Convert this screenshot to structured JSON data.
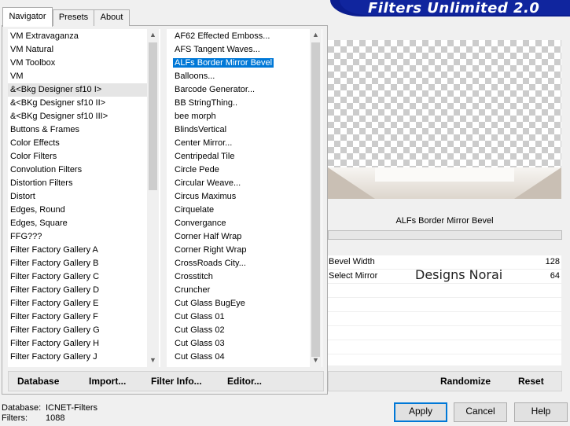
{
  "tabs": [
    "Navigator",
    "Presets",
    "About"
  ],
  "banner_title": "Filters Unlimited 2.0",
  "categories": {
    "items": [
      "VM Extravaganza",
      "VM Natural",
      "VM Toolbox",
      "VM",
      "&<Bkg Designer sf10 I>",
      "&<BKg Designer sf10 II>",
      "&<BKg Designer sf10 III>",
      "Buttons & Frames",
      "Color Effects",
      "Color Filters",
      "Convolution Filters",
      "Distortion Filters",
      "Distort",
      "Edges, Round",
      "Edges, Square",
      "FFG???",
      "Filter Factory Gallery A",
      "Filter Factory Gallery B",
      "Filter Factory Gallery C",
      "Filter Factory Gallery D",
      "Filter Factory Gallery E",
      "Filter Factory Gallery F",
      "Filter Factory Gallery G",
      "Filter Factory Gallery H",
      "Filter Factory Gallery J"
    ]
  },
  "filters": {
    "items": [
      "AF62 Effected Emboss...",
      "AFS Tangent Waves...",
      "ALFs Border Mirror Bevel",
      "Balloons...",
      "Barcode Generator...",
      "BB StringThing..",
      "bee morph",
      "BlindsVertical",
      "Center Mirror...",
      "Centripedal Tile",
      "Circle Pede",
      "Circular Weave...",
      "Circus Maximus",
      "Cirquelate",
      "Convergance",
      "Corner Half Wrap",
      "Corner Right Wrap",
      "CrossRoads City...",
      "Crosstitch",
      "Cruncher",
      "Cut Glass  BugEye",
      "Cut Glass 01",
      "Cut Glass 02",
      "Cut Glass 03",
      "Cut Glass 04"
    ],
    "selected_index": 2
  },
  "preview": {
    "filter_name": "ALFs Border Mirror Bevel"
  },
  "params": [
    {
      "label": "Bevel Width",
      "value": "128",
      "level": 0.502
    },
    {
      "label": "Select Mirror",
      "value": "64",
      "level": 0.251
    }
  ],
  "watermark": "Designs Norai",
  "left_buttons": [
    "Database",
    "Import...",
    "Filter Info...",
    "Editor..."
  ],
  "right_buttons": [
    "Randomize",
    "Reset"
  ],
  "status": {
    "database_label": "Database:",
    "database_value": "ICNET-Filters",
    "filters_label": "Filters:",
    "filters_value": "1088"
  },
  "dialog_buttons": {
    "apply": "Apply",
    "cancel": "Cancel",
    "help": "Help"
  },
  "colors": {
    "banner": "#10259e",
    "selection": "#0078d7"
  }
}
